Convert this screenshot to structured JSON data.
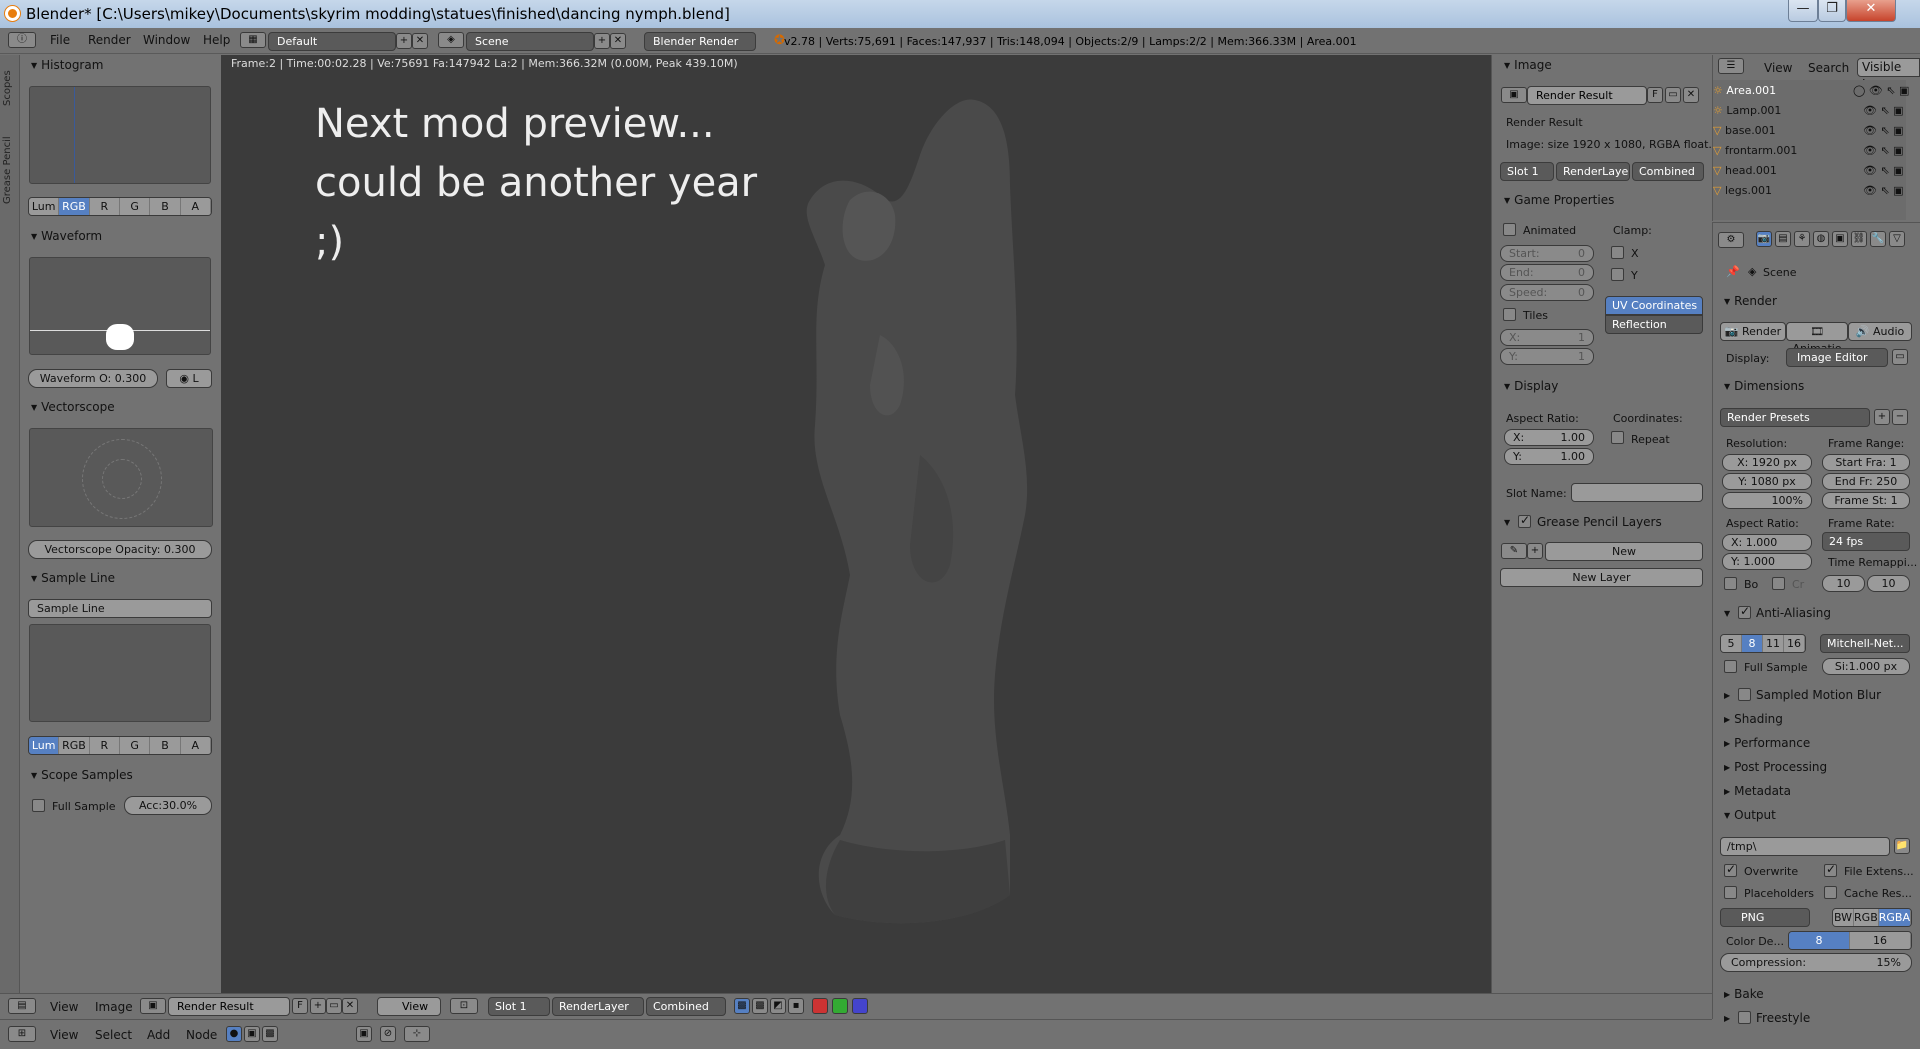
{
  "window": {
    "title": "Blender* [C:\\Users\\mikey\\Documents\\skyrim modding\\statues\\finished\\dancing nymph.blend]",
    "btn_min": "—",
    "btn_max": "❐",
    "btn_close": "✕"
  },
  "menu": {
    "items": [
      "File",
      "Render",
      "Window",
      "Help"
    ],
    "layout": "Default",
    "scene": "Scene",
    "engine": "Blender Render",
    "stats": "v2.78 | Verts:75,691 | Faces:147,937 | Tris:148,094 | Objects:2/9 | Lamps:2/2 | Mem:366.33M | Area.001"
  },
  "left_tabs": [
    "Scopes",
    "Grease Pencil"
  ],
  "scopes": {
    "histogram": "Histogram",
    "waveform": "Waveform",
    "waveform_opacity": "Waveform O:  0.300",
    "waveform_mode": "L",
    "vectorscope": "Vectorscope",
    "vectorscope_opacity": "Vectorscope Opacity:   0.300",
    "sample_line": "Sample Line",
    "sample_line_btn": "Sample Line",
    "scope_samples": "Scope Samples",
    "full_sample": "Full Sample",
    "accuracy": "Acc:30.0%",
    "channels": [
      "Lum",
      "RGB",
      "R",
      "G",
      "B",
      "A"
    ]
  },
  "viewport": {
    "info": "Frame:2 | Time:00:02.28 | Ve:75691 Fa:147942 La:2 | Mem:366.32M (0.00M, Peak 439.10M)",
    "annotation": "Next mod preview...\ncould be another year\n;)"
  },
  "image_panel": {
    "image_header": "Image",
    "render_result": "Render Result",
    "f_label": "F",
    "render_result_label": "Render Result",
    "image_size": "Image: size 1920 x 1080, RGBA float...",
    "slot": "Slot 1",
    "render_layer": "RenderLaye",
    "pass": "Combined",
    "game_properties": "Game Properties",
    "animated": "Animated",
    "clamp": "Clamp:",
    "clamp_x": "X",
    "clamp_y": "Y",
    "start": "Start:",
    "end": "End:",
    "speed": "Speed:",
    "zero": "0",
    "uv_coordinates": "UV Coordinates",
    "reflection": "Reflection",
    "tiles": "Tiles",
    "tile_x": "X:",
    "tile_y": "Y:",
    "one": "1",
    "display": "Display",
    "aspect_ratio": "Aspect Ratio:",
    "coordinates": "Coordinates:",
    "aspect_x": "X:",
    "aspect_y": "Y:",
    "aspect_val": "1.00",
    "repeat": "Repeat",
    "slot_name": "Slot Name:",
    "grease_pencil_layers": "Grease Pencil Layers",
    "new": "New",
    "new_layer": "New Layer"
  },
  "outliner": {
    "view": "View",
    "search": "Search",
    "visible_layers": "Visible Laye",
    "rows": [
      "Area.001",
      "Lamp.001",
      "base.001",
      "frontarm.001",
      "head.001",
      "legs.001"
    ]
  },
  "properties": {
    "scene": "Scene",
    "render": "Render",
    "render_btn": "Render",
    "animation_btn": "Animatio",
    "audio_btn": "Audio",
    "display_label": "Display:",
    "display_value": "Image Editor",
    "dimensions": "Dimensions",
    "render_presets": "Render Presets",
    "resolution": "Resolution:",
    "frame_range": "Frame Range:",
    "res_x": "X:  1920 px",
    "res_y": "Y:  1080 px",
    "res_pct": "100%",
    "start_frame": "Start Fra:   1",
    "end_frame": "End Fr:  250",
    "frame_step": "Frame St:   1",
    "aspect_ratio": "Aspect Ratio:",
    "frame_rate": "Frame Rate:",
    "asp_x": "X:        1.000",
    "asp_y": "Y:        1.000",
    "fps": "24 fps",
    "time_remap": "Time Remappi...",
    "bo": "Bo",
    "cr": "Cr",
    "remap_old": "10",
    "remap_new": "10",
    "anti_aliasing": "Anti-Aliasing",
    "aa_samples": [
      "5",
      "8",
      "11",
      "16"
    ],
    "aa_filter": "Mitchell-Net...",
    "full_sample": "Full Sample",
    "filter_size": "Si:1.000 px",
    "sampled_motion_blur": "Sampled Motion Blur",
    "shading": "Shading",
    "performance": "Performance",
    "post_processing": "Post Processing",
    "metadata": "Metadata",
    "output": "Output",
    "output_path": "/tmp\\",
    "overwrite": "Overwrite",
    "file_extensions": "File Extens...",
    "placeholders": "Placeholders",
    "cache_result": "Cache Res...",
    "format": "PNG",
    "bw": "BW",
    "rgb": "RGB",
    "rgba": "RGBA",
    "color_depth": "Color De...",
    "depth_8": "8",
    "depth_16": "16",
    "compression": "Compression:",
    "compression_val": "15%",
    "bake": "Bake",
    "freestyle": "Freestyle"
  },
  "bottom_bar": {
    "view": "View",
    "image": "Image",
    "render_result": "Render Result",
    "f": "F",
    "view2": "View",
    "slot": "Slot 1",
    "render_layer": "RenderLayer",
    "pass": "Combined"
  },
  "node_bar": {
    "items": [
      "View",
      "Select",
      "Add",
      "Node"
    ]
  }
}
